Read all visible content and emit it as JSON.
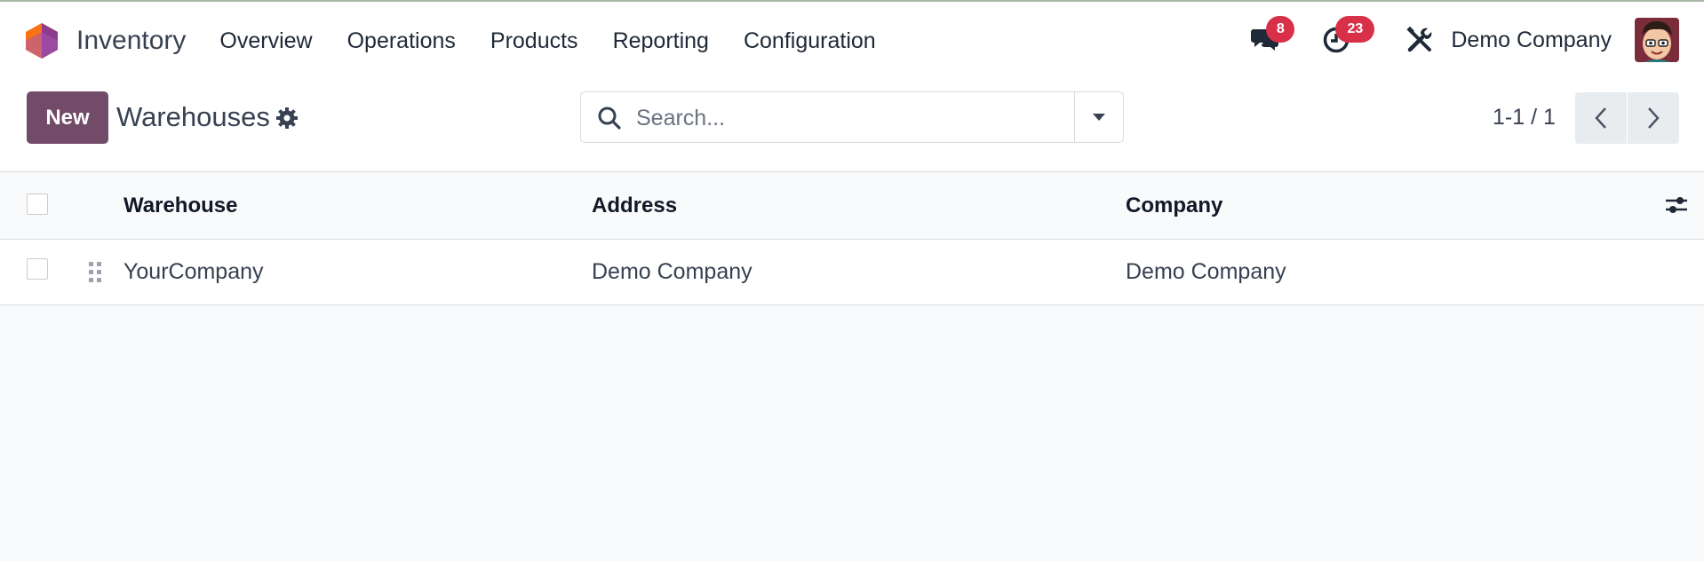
{
  "app": {
    "name": "Inventory",
    "logo_icon": "odoo-inventory-logo"
  },
  "menu": {
    "items": [
      {
        "label": "Overview"
      },
      {
        "label": "Operations"
      },
      {
        "label": "Products"
      },
      {
        "label": "Reporting"
      },
      {
        "label": "Configuration"
      }
    ]
  },
  "systray": {
    "messages_icon": "chat-bubbles-icon",
    "messages_count": "8",
    "activities_icon": "clock-icon",
    "activities_count": "23",
    "debug_icon": "tools-icon",
    "company": "Demo Company",
    "avatar_icon": "user-avatar",
    "badge_color": "#d9304a"
  },
  "control_panel": {
    "new_label": "New",
    "title": "Warehouses",
    "settings_icon": "gear-icon",
    "search_placeholder": "Search...",
    "pager_value": "1-1 / 1",
    "accent_color": "#714b67"
  },
  "table": {
    "columns": [
      {
        "label": "Warehouse"
      },
      {
        "label": "Address"
      },
      {
        "label": "Company"
      }
    ],
    "rows": [
      {
        "warehouse": "YourCompany",
        "address": "Demo Company",
        "company": "Demo Company"
      }
    ],
    "optional_columns_icon": "sliders-icon"
  }
}
